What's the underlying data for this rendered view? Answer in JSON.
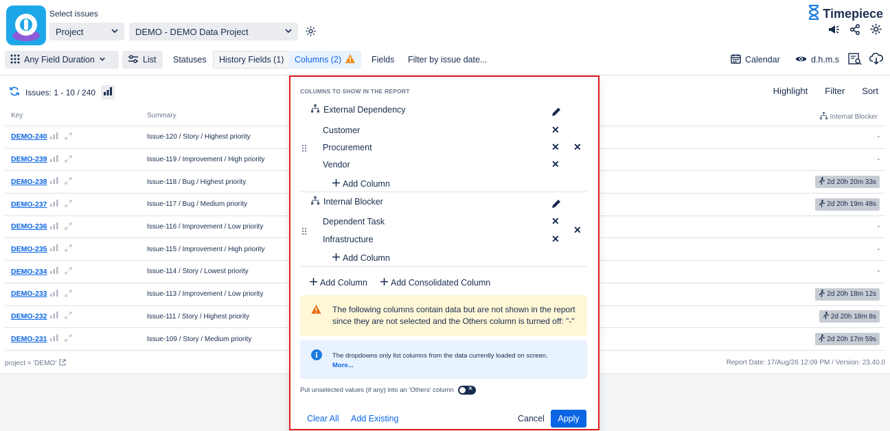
{
  "header": {
    "select_label": "Select issues",
    "project_dropdown": "Project",
    "project_value": "DEMO - DEMO Data Project",
    "brand": "Timepiece"
  },
  "toolbar": {
    "duration": "Any Field Duration",
    "list": "List",
    "statuses": "Statuses",
    "history_fields": "History Fields (1)",
    "columns": "Columns (2)",
    "fields": "Fields",
    "filter_by_date": "Filter by issue date...",
    "calendar": "Calendar",
    "format": "d.h.m.s"
  },
  "issues": {
    "count": "Issues: 1 - 10 / 240",
    "highlight": "Highlight",
    "filter": "Filter",
    "sort": "Sort",
    "col_key": "Key",
    "col_summary": "Summary",
    "col_internal_blocker": "Internal Blocker",
    "rows": [
      {
        "key": "DEMO-240",
        "summary": "Issue-120 / Story / Highest priority",
        "value": "-"
      },
      {
        "key": "DEMO-239",
        "summary": "Issue-119 / Improvement / High priority",
        "value": "-"
      },
      {
        "key": "DEMO-238",
        "summary": "Issue-118 / Bug / Highest priority",
        "value": "2d 20h 20m 33s"
      },
      {
        "key": "DEMO-237",
        "summary": "Issue-117 / Bug / Medium priority",
        "value": "2d 20h 19m 48s"
      },
      {
        "key": "DEMO-236",
        "summary": "Issue-116 / Improvement / Low priority",
        "value": "-"
      },
      {
        "key": "DEMO-235",
        "summary": "Issue-115 / Improvement / High priority",
        "value": "-"
      },
      {
        "key": "DEMO-234",
        "summary": "Issue-114 / Story / Lowest priority",
        "value": "-"
      },
      {
        "key": "DEMO-233",
        "summary": "Issue-113 / Improvement / Low priority",
        "value": "2d 20h 18m 12s"
      },
      {
        "key": "DEMO-232",
        "summary": "Issue-111 / Story / Highest priority",
        "value": "2d 20h 18m 8s"
      },
      {
        "key": "DEMO-231",
        "summary": "Issue-109 / Story / Medium priority",
        "value": "2d 20h 17m 59s"
      }
    ],
    "jql": "project = 'DEMO'",
    "report_info": "Report Date: 17/Aug/26 12:09 PM / Version: 23.40.0"
  },
  "popup": {
    "title": "COLUMNS TO SHOW IN THE REPORT",
    "group1": {
      "name": "External Dependency",
      "items": [
        "Customer",
        "Procurement",
        "Vendor"
      ],
      "add": "Add Column"
    },
    "group2": {
      "name": "Internal Blocker",
      "items": [
        "Dependent Task",
        "Infrastructure"
      ],
      "add": "Add Column"
    },
    "add_column": "Add Column",
    "add_consolidated": "Add Consolidated Column",
    "warning": "The following columns contain data but are not shown in the report since they are not selected and the Others column is turned off: \"-\"",
    "info": "The dropdowns only list columns from the data currently loaded on screen.",
    "info_more": "More...",
    "toggle_label": "Put unselected values (if any) into an 'Others' column",
    "clear_all": "Clear All",
    "add_existing": "Add Existing",
    "cancel": "Cancel",
    "apply": "Apply"
  }
}
